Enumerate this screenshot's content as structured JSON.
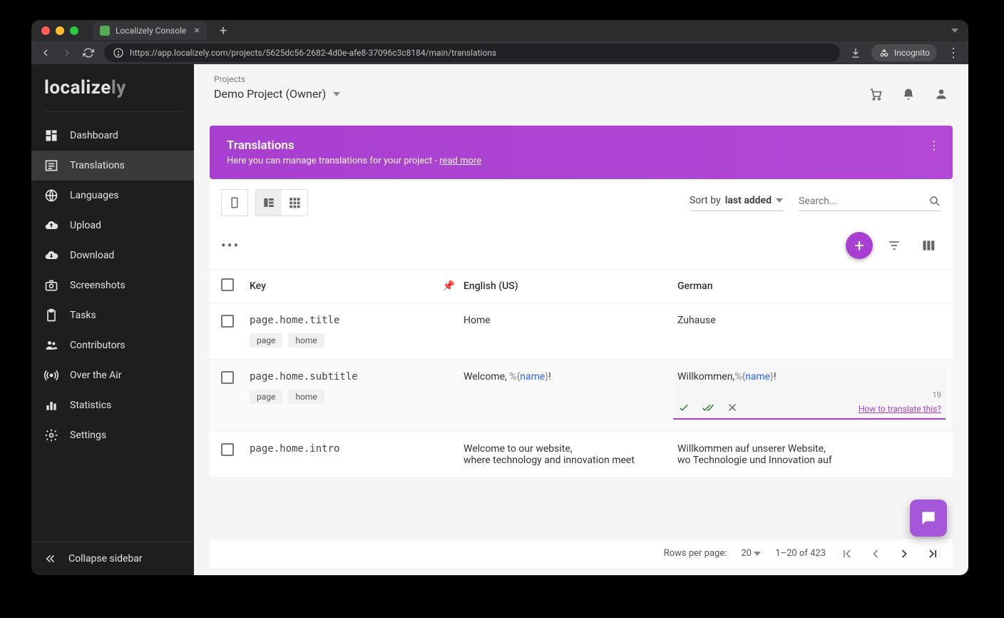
{
  "browser": {
    "tab_title": "Localizely Console",
    "url": "https://app.localizely.com/projects/5625dc56-2682-4d0e-afe8-37096c3c8184/main/translations",
    "incognito": "Incognito"
  },
  "logo": {
    "a": "localize",
    "b": "ly"
  },
  "sidebar": {
    "items": [
      {
        "label": "Dashboard"
      },
      {
        "label": "Translations"
      },
      {
        "label": "Languages"
      },
      {
        "label": "Upload"
      },
      {
        "label": "Download"
      },
      {
        "label": "Screenshots"
      },
      {
        "label": "Tasks"
      },
      {
        "label": "Contributors"
      },
      {
        "label": "Over the Air"
      },
      {
        "label": "Statistics"
      },
      {
        "label": "Settings"
      }
    ],
    "collapse": "Collapse sidebar"
  },
  "header": {
    "breadcrumb": "Projects",
    "project": "Demo Project (Owner)"
  },
  "banner": {
    "title": "Translations",
    "text": "Here you can manage translations for your project - ",
    "link": "read more"
  },
  "controls": {
    "sort_prefix": "Sort by ",
    "sort_value": "last added",
    "search_placeholder": "Search..."
  },
  "table": {
    "headers": {
      "key": "Key",
      "en": "English (US)",
      "de": "German"
    },
    "rows": [
      {
        "key": "page.home.title",
        "tags": [
          "page",
          "home"
        ],
        "en": "Home",
        "de": "Zuhause"
      },
      {
        "key": "page.home.subtitle",
        "tags": [
          "page",
          "home"
        ],
        "en_pre": "Welcome, ",
        "en_ph_open": "%{",
        "en_ph": "name",
        "en_ph_close": "}",
        "en_post": "!",
        "de_pre": "Willkommen,",
        "de_ph_open": "%{",
        "de_ph": "name",
        "de_ph_close": "}",
        "de_post": "!",
        "editing": true,
        "char_count": "19",
        "help": "How to translate this?"
      },
      {
        "key": "page.home.intro",
        "tags": [],
        "en_l1": "Welcome to our website,",
        "en_l2": "where technology and innovation meet",
        "de_l1": "Willkommen auf unserer Website,",
        "de_l2": "wo Technologie und Innovation auf"
      }
    ]
  },
  "pager": {
    "rpp_label": "Rows per page:",
    "rpp_value": "20",
    "range": "1–20 of 423"
  }
}
